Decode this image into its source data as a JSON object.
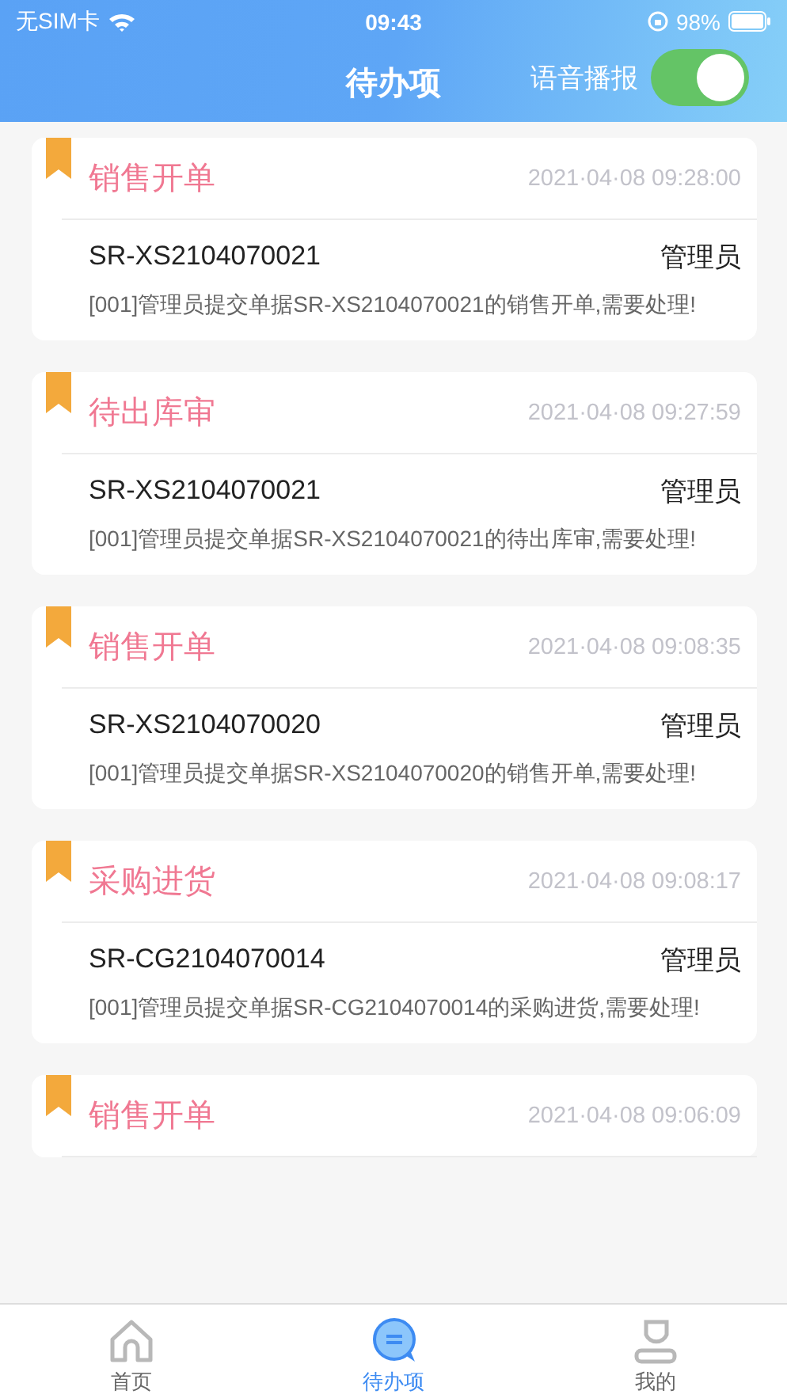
{
  "status_bar": {
    "carrier": "无SIM卡",
    "time": "09:43",
    "battery": "98%"
  },
  "header": {
    "title": "待办项",
    "voice": {
      "label": "语音播报",
      "on": true
    }
  },
  "tasks": [
    {
      "title": "销售开单",
      "time": "2021·04·08 09:28:00",
      "code": "SR-XS2104070021",
      "user": "管理员",
      "message": "[001]管理员提交单据SR-XS2104070021的销售开单,需要处理!"
    },
    {
      "title": "待出库审",
      "time": "2021·04·08 09:27:59",
      "code": "SR-XS2104070021",
      "user": "管理员",
      "message": "[001]管理员提交单据SR-XS2104070021的待出库审,需要处理!"
    },
    {
      "title": "销售开单",
      "time": "2021·04·08 09:08:35",
      "code": "SR-XS2104070020",
      "user": "管理员",
      "message": "[001]管理员提交单据SR-XS2104070020的销售开单,需要处理!"
    },
    {
      "title": "采购进货",
      "time": "2021·04·08 09:08:17",
      "code": "SR-CG2104070014",
      "user": "管理员",
      "message": "[001]管理员提交单据SR-CG2104070014的采购进货,需要处理!"
    },
    {
      "title": "销售开单",
      "time": "2021·04·08 09:06:09"
    }
  ],
  "tab_bar": [
    {
      "label": "首页",
      "kind": "home",
      "selected": false
    },
    {
      "label": "待办项",
      "kind": "todo",
      "selected": true
    },
    {
      "label": "我的",
      "kind": "profile",
      "selected": false
    }
  ]
}
